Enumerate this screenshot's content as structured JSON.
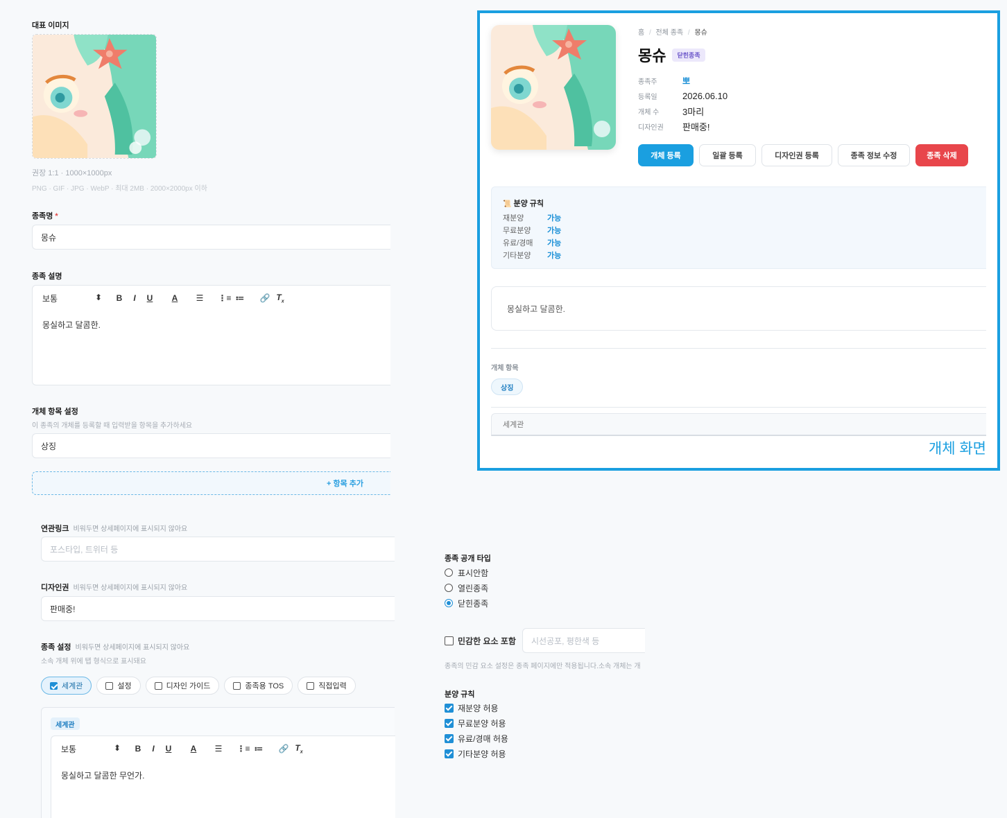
{
  "form": {
    "image": {
      "label": "대표 이미지",
      "hint1": "권장 1:1 · 1000×1000px",
      "hint2": "PNG · GIF · JPG · WebP · 최대 2MB · 2000×2000px 이하"
    },
    "name": {
      "label": "종족명",
      "required_mark": "*",
      "value": "몽슈"
    },
    "description": {
      "label": "종족 설명",
      "toolbar_select": "보통",
      "content": "몽실하고 달콤한."
    },
    "fields": {
      "label": "개체 항목 설정",
      "hint": "이 종족의 개체를 등록할 때 입력받을 항목을 추가하세요",
      "items": [
        "상징"
      ],
      "add_label": "+ 항목 추가"
    },
    "link": {
      "label": "연관링크",
      "hint": "비워두면 상세페이지에 표시되지 않아요",
      "placeholder": "포스타입, 트위터 등"
    },
    "design_right": {
      "label": "디자인권",
      "hint": "비워두면 상세페이지에 표시되지 않아요",
      "value": "판매중!"
    },
    "settings": {
      "label": "종족 설정",
      "hint": "비워두면 상세페이지에 표시되지 않아요",
      "subhint": "소속 개체 위에 탭 형식으로 표시돼요",
      "chips": [
        {
          "label": "세계관",
          "checked": true
        },
        {
          "label": "설정",
          "checked": false
        },
        {
          "label": "디자인 가이드",
          "checked": false
        },
        {
          "label": "종족용 TOS",
          "checked": false
        },
        {
          "label": "직접입력",
          "checked": false
        }
      ],
      "panel_tag": "세계관",
      "toolbar_select": "보통",
      "content": "몽실하고 달콤한 무언가."
    },
    "visibility": {
      "label": "종족 공개 타입",
      "options": [
        {
          "label": "표시안함",
          "checked": false
        },
        {
          "label": "열린종족",
          "checked": false
        },
        {
          "label": "닫힌종족",
          "checked": true
        }
      ]
    },
    "sensitive": {
      "label": "민감한 요소 포함",
      "checked": false,
      "placeholder": "시선공포, 평한색 등",
      "note": "종족의 민감 요소 설정은 종족 페이지에만 적용됩니다.소속 개체는 개"
    },
    "distribution": {
      "label": "분양 규칙",
      "options": [
        {
          "label": "재분양 허용",
          "checked": true
        },
        {
          "label": "무료분양 허용",
          "checked": true
        },
        {
          "label": "유료/경매 허용",
          "checked": true
        },
        {
          "label": "기타분양 허용",
          "checked": true
        }
      ]
    }
  },
  "preview": {
    "breadcrumb": [
      "홈",
      "전체 종족",
      "몽슈"
    ],
    "title": "몽슈",
    "badge": "닫힌종족",
    "meta": [
      {
        "k": "종족주",
        "v": "뽀"
      },
      {
        "k": "등록일",
        "v": "2026.06.10"
      },
      {
        "k": "개체 수",
        "v": "3마리"
      },
      {
        "k": "디자인권",
        "v": "판매중!"
      }
    ],
    "buttons": {
      "register": "개체 등록",
      "bulk": "일괄 등록",
      "design": "디자인권 등록",
      "edit": "종족 정보 수정",
      "delete": "종족 삭제"
    },
    "rules": {
      "icon": "📜",
      "title": "분양 규칙",
      "items": [
        {
          "k": "재분양",
          "v": "가능"
        },
        {
          "k": "무료분양",
          "v": "가능"
        },
        {
          "k": "유료/경매",
          "v": "가능"
        },
        {
          "k": "기타분양",
          "v": "가능"
        }
      ]
    },
    "description": "몽실하고 달콤한.",
    "fields_label": "개체 항목",
    "field_tag": "상징",
    "tab_label": "세계관",
    "caption": "개체 화면"
  },
  "colors": {
    "accent": "#1a9fe0",
    "danger": "#e8464b"
  }
}
